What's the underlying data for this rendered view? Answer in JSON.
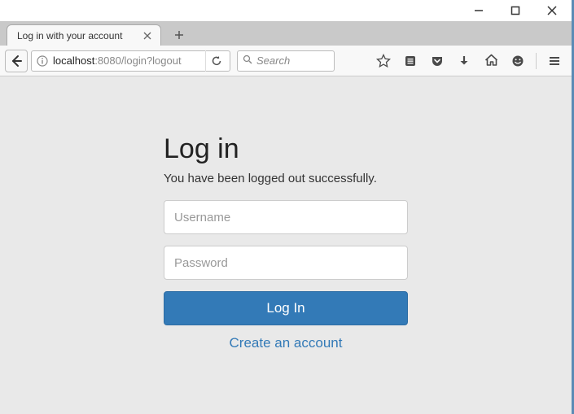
{
  "window": {
    "controls": {
      "min": "minimize",
      "max": "maximize",
      "close": "close"
    }
  },
  "tab": {
    "title": "Log in with your account"
  },
  "url": {
    "host": "localhost",
    "port": ":8080",
    "path": "/login?logout"
  },
  "search": {
    "placeholder": "Search"
  },
  "login": {
    "heading": "Log in",
    "message": "You have been logged out successfully.",
    "username_placeholder": "Username",
    "password_placeholder": "Password",
    "button_label": "Log In",
    "create_link": "Create an account"
  },
  "colors": {
    "primary": "#337ab7",
    "page_bg": "#e9e9e9"
  }
}
